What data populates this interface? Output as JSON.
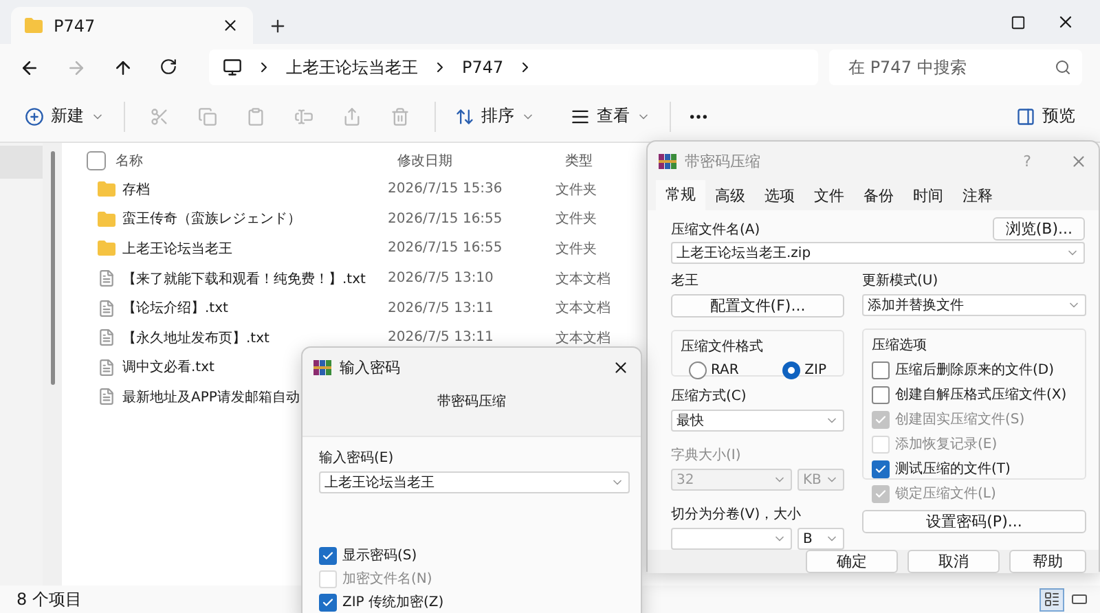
{
  "explorer": {
    "tab": {
      "title": "P747",
      "selected": true
    },
    "breadcrumb": [
      "上老王论坛当老王",
      "P747"
    ],
    "search": {
      "placeholder": "在 P747 中搜索"
    },
    "toolbar": {
      "new": "新建",
      "sort": "排序",
      "view": "查看",
      "preview": "预览"
    },
    "columns": [
      "名称",
      "修改日期",
      "类型"
    ],
    "all_selected": false,
    "files": [
      {
        "kind": "folder",
        "name": "存档",
        "modified": "2026/7/15 15:36",
        "type": "文件夹"
      },
      {
        "kind": "folder",
        "name": "蛮王传奇（蛮族レジェンド）",
        "modified": "2026/7/15 16:55",
        "type": "文件夹"
      },
      {
        "kind": "folder",
        "name": "上老王论坛当老王",
        "modified": "2026/7/15 16:55",
        "type": "文件夹"
      },
      {
        "kind": "text",
        "name": "【来了就能下载和观看！纯免费！】.txt",
        "modified": "2026/7/5 13:10",
        "type": "文本文档"
      },
      {
        "kind": "text",
        "name": "【论坛介绍】.txt",
        "modified": "2026/7/5 13:11",
        "type": "文本文档"
      },
      {
        "kind": "text",
        "name": "【永久地址发布页】.txt",
        "modified": "2026/7/5 13:11",
        "type": "文本文档"
      },
      {
        "kind": "text",
        "name": "调中文必看.txt"
      },
      {
        "kind": "text",
        "name": "最新地址及APP请发邮箱自动"
      }
    ],
    "status": "8 个项目",
    "view_modes": [
      {
        "kind": "details",
        "selected": true
      },
      {
        "kind": "tiles",
        "selected": false
      }
    ]
  },
  "archive_dialog": {
    "title": "带密码压缩",
    "help": "?",
    "tabs": [
      {
        "label": "常规",
        "selected": true
      },
      {
        "label": "高级",
        "selected": false
      },
      {
        "label": "选项",
        "selected": false
      },
      {
        "label": "文件",
        "selected": false
      },
      {
        "label": "备份",
        "selected": false
      },
      {
        "label": "时间",
        "selected": false
      },
      {
        "label": "注释",
        "selected": false
      }
    ],
    "archive_name_label": "压缩文件名(A)",
    "browse": "浏览(B)...",
    "archive_name": "上老王论坛当老王.zip",
    "profile_label": "老王",
    "profile_button": "配置文件(F)...",
    "update_label": "更新模式(U)",
    "update_mode": "添加并替换文件",
    "format_label": "压缩文件格式",
    "formats": [
      {
        "label": "RAR",
        "selected": false
      },
      {
        "label": "ZIP",
        "selected": true
      }
    ],
    "method_label": "压缩方式(C)",
    "method": "最快",
    "dict_label": "字典大小(I)",
    "dict_size": "32",
    "dict_unit": "KB",
    "dict_disabled": true,
    "split_label": "切分为分卷(V)，大小",
    "split_unit": "B",
    "options_label": "压缩选项",
    "options": [
      {
        "label": "压缩后删除原来的文件(D)",
        "checked": false,
        "disabled": false
      },
      {
        "label": "创建自解压格式压缩文件(X)",
        "checked": false,
        "disabled": false
      },
      {
        "label": "创建固实压缩文件(S)",
        "checked": true,
        "disabled": true
      },
      {
        "label": "添加恢复记录(E)",
        "checked": false,
        "disabled": true
      },
      {
        "label": "测试压缩的文件(T)",
        "checked": true,
        "disabled": false
      },
      {
        "label": "锁定压缩文件(L)",
        "checked": true,
        "disabled": true
      }
    ],
    "password_button": "设置密码(P)...",
    "buttons": [
      "确定",
      "取消",
      "帮助"
    ]
  },
  "password_dialog": {
    "title": "输入密码",
    "subtitle": "带密码压缩",
    "password_label": "输入密码(E)",
    "password": "上老王论坛当老王",
    "options": [
      {
        "label": "显示密码(S)",
        "checked": true,
        "disabled": false
      },
      {
        "label": "加密文件名(N)",
        "checked": false,
        "disabled": true
      },
      {
        "label": "ZIP 传统加密(Z)",
        "checked": true,
        "disabled": false
      }
    ]
  }
}
